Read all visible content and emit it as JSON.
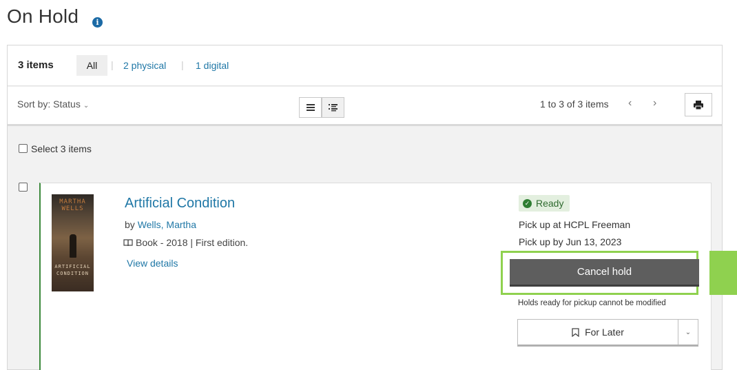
{
  "page": {
    "title": "On Hold",
    "info_icon": "info-icon"
  },
  "filter": {
    "count": "3 items",
    "tabs": [
      {
        "label": "All",
        "active": true
      },
      {
        "label": "2 physical",
        "active": false
      },
      {
        "label": "1 digital",
        "active": false
      }
    ],
    "separator": "|"
  },
  "toolbar": {
    "sort_label": "Sort by: Status",
    "view_icons": [
      "list-view-icon",
      "detail-view-icon"
    ],
    "pager_text": "1 to 3 of 3 items",
    "prev_label": "‹",
    "next_label": "›",
    "print_icon": "print-icon"
  },
  "select_all": {
    "label": "Select 3 items"
  },
  "items": [
    {
      "title": "Artificial Condition",
      "author_prefix": "by",
      "author": "Wells, Martha",
      "format": "Book - 2018 | First edition.",
      "format_icon": "book-icon",
      "details_link": "View details",
      "cover": {
        "author_text": "MARTHA WELLS",
        "title_text": "ARTIFICIAL CONDITION"
      },
      "status": "Ready",
      "pickup_location": "Pick up at HCPL Freeman",
      "pickup_by": "Pick up by Jun 13, 2023",
      "cancel_label": "Cancel hold",
      "note": "Holds ready for pickup cannot be modified",
      "for_later_label": "For Later"
    }
  ],
  "colors": {
    "link": "#1f77a6",
    "ready_bg": "#e3efdf",
    "ready_fg": "#2f6b2f",
    "highlight": "#8fd14f",
    "cancel_bg": "#5e5e5e"
  }
}
